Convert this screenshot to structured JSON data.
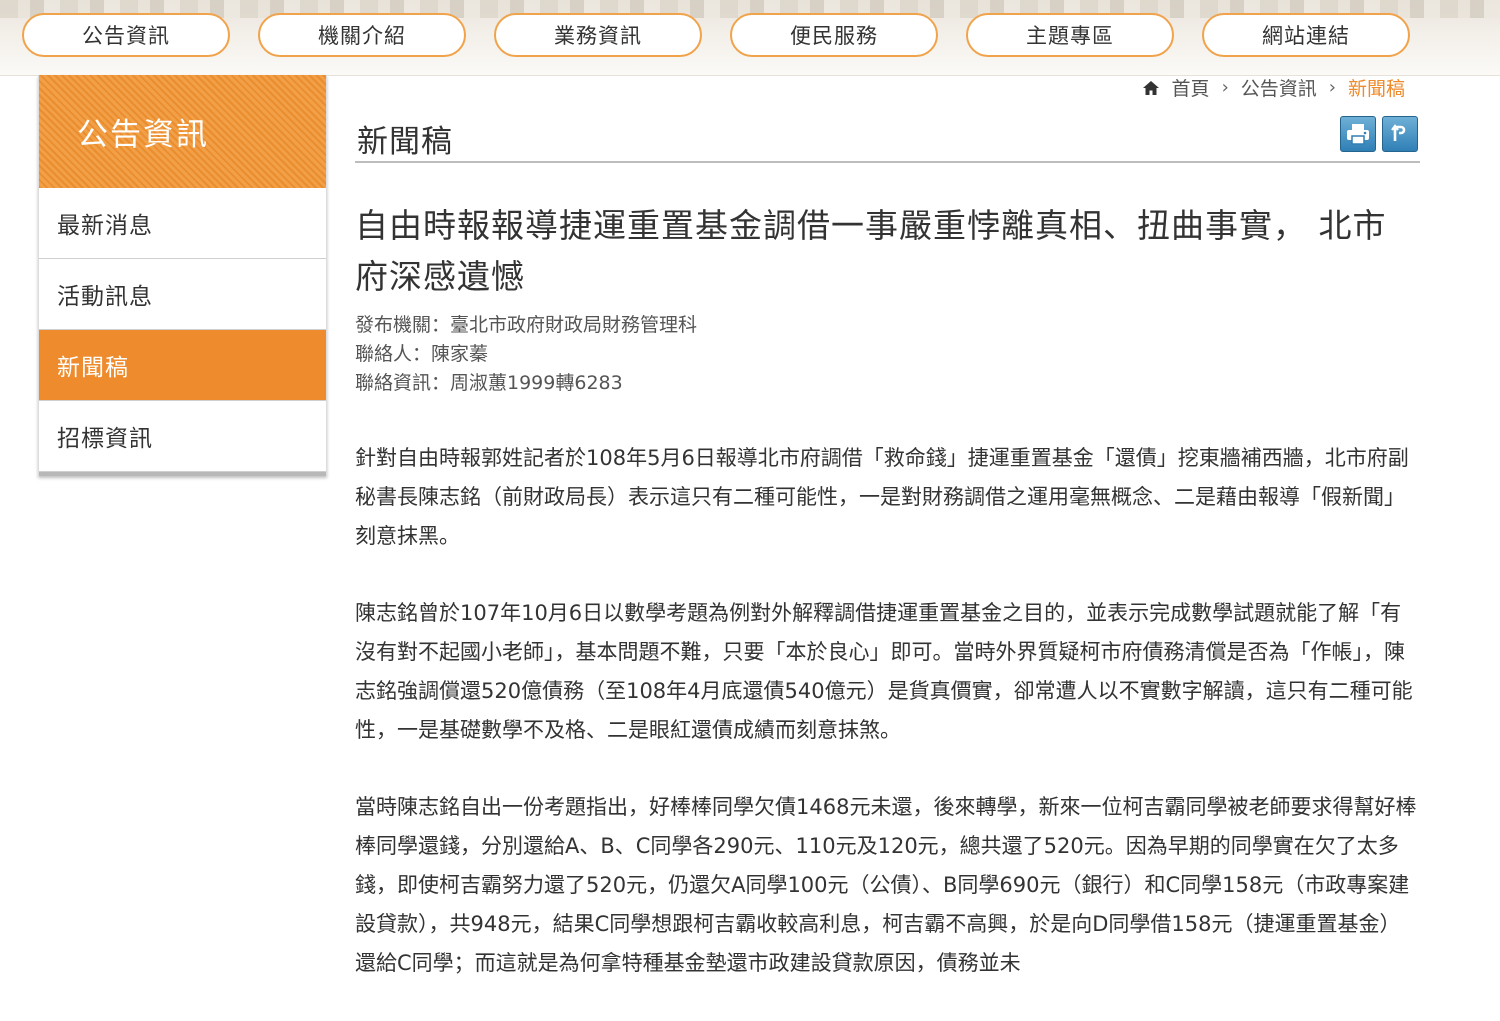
{
  "nav": {
    "items": [
      "公告資訊",
      "機關介紹",
      "業務資訊",
      "便民服務",
      "主題專區",
      "網站連結"
    ]
  },
  "sidebar": {
    "title": "公告資訊",
    "items": [
      {
        "label": "最新消息",
        "active": false
      },
      {
        "label": "活動訊息",
        "active": false
      },
      {
        "label": "新聞稿",
        "active": true
      },
      {
        "label": "招標資訊",
        "active": false
      }
    ]
  },
  "breadcrumb": {
    "home": "首頁",
    "section": "公告資訊",
    "current": "新聞稿"
  },
  "page": {
    "title": "新聞稿",
    "icons": [
      "print-icon",
      "back-icon"
    ]
  },
  "article": {
    "title": "自由時報報導捷運重置基金調借一事嚴重悖離真相、扭曲事實， 北市府深感遺憾",
    "publisher": "發布機關：臺北市政府財政局財務管理科",
    "contact": "聯絡人：陳家蓁",
    "contact_info": "聯絡資訊：周淑蕙1999轉6283",
    "paragraphs": [
      "針對自由時報郭姓記者於108年5月6日報導北市府調借「救命錢」捷運重置基金「還債」挖東牆補西牆，北市府副秘書長陳志銘（前財政局長）表示這只有二種可能性，一是對財務調借之運用毫無概念、二是藉由報導「假新聞」刻意抹黑。",
      "陳志銘曾於107年10月6日以數學考題為例對外解釋調借捷運重置基金之目的，並表示完成數學試題就能了解「有沒有對不起國小老師」，基本問題不難，只要「本於良心」即可。當時外界質疑柯市府債務清償是否為「作帳」，陳志銘強調償還520億債務（至108年4月底還債540億元）是貨真價實，卻常遭人以不實數字解讀，這只有二種可能性，一是基礎數學不及格、二是眼紅還債成績而刻意抹煞。",
      "當時陳志銘自出一份考題指出，好棒棒同學欠債1468元未還，後來轉學，新來一位柯吉霸同學被老師要求得幫好棒棒同學還錢，分別還給A、B、C同學各290元、110元及120元，總共還了520元。因為早期的同學實在欠了太多錢，即使柯吉霸努力還了520元，仍還欠A同學100元（公債）、B同學690元（銀行）和C同學158元（市政專案建設貸款），共948元，結果C同學想跟柯吉霸收較高利息，柯吉霸不高興，於是向D同學借158元（捷運重置基金）還給C同學；而這就是為何拿特種基金墊還市政建設貸款原因，債務並未"
    ]
  },
  "colors": {
    "accent": "#ee8b2c",
    "nav_border": "#f0a34b",
    "icon_blue": "#2f7fb6"
  }
}
